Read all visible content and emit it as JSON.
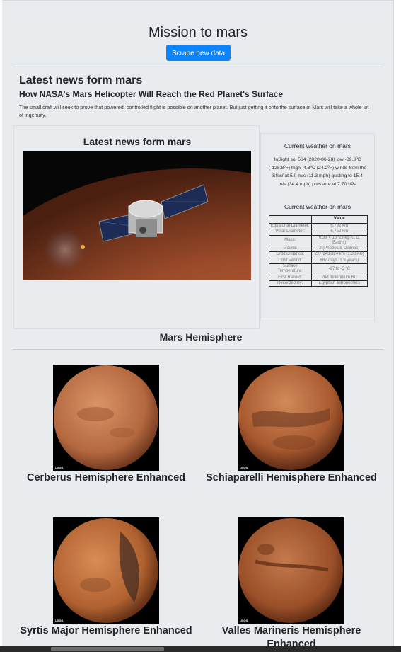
{
  "header": {
    "title": "Mission to mars",
    "scrape_button": "Scrape new data"
  },
  "news": {
    "heading": "Latest news form mars",
    "title": "How NASA's Mars Helicopter Will Reach the Red Planet's Surface",
    "paragraph": "The small craft will seek to prove that powered, controlled flight is possible on another planet. But just getting it onto the surface of Mars will take a whole lot of ingenuity."
  },
  "featured": {
    "heading": "Latest news form mars",
    "image_alt": "spacecraft orbiting mars"
  },
  "weather": {
    "heading": "Current weather on mars",
    "text": "InSight sol 564 (2020-06-28) low -89.3ºC (-128.8ºF) high -4.3ºC (24.2ºF) winds from the SSW at 5.0 m/s (11.3 mph) gusting to 15.4 m/s (34.4 mph) pressure at 7.70 hPa",
    "facts_heading": "Current weather on mars",
    "facts_header": [
      "",
      "Value"
    ],
    "facts": [
      {
        "label": "Equatorial Diameter:",
        "value": "6,792 km"
      },
      {
        "label": "Polar Diameter:",
        "value": "6,752 km"
      },
      {
        "label": "Mass:",
        "value": "6.39 × 10^23 kg (0.11 Earths)"
      },
      {
        "label": "Moons:",
        "value": "2 (Phobos & Deimos)"
      },
      {
        "label": "Orbit Distance:",
        "value": "227,943,824 km (1.38 AU)"
      },
      {
        "label": "Orbit Period:",
        "value": "687 days (1.9 years)"
      },
      {
        "label": "Surface Temperature:",
        "value": "-87 to -5 °C"
      },
      {
        "label": "First Record:",
        "value": "2nd millennium BC"
      },
      {
        "label": "Recorded By:",
        "value": "Egyptian astronomers"
      }
    ]
  },
  "hemispheres": {
    "heading": "Mars Hemisphere",
    "items": [
      {
        "name": "Cerberus Hemisphere Enhanced",
        "logo": "USGS"
      },
      {
        "name": "Schiaparelli Hemisphere Enhanced",
        "logo": "USGS"
      },
      {
        "name": "Syrtis Major Hemisphere Enhanced",
        "logo": "USGS"
      },
      {
        "name": "Valles Marineris Hemisphere Enhanced",
        "logo": "USGS"
      }
    ]
  }
}
